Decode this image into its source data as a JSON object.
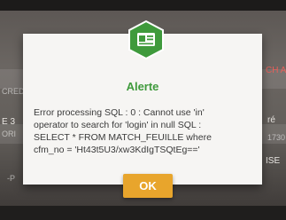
{
  "background": {
    "left_partial_1": "CRED",
    "left_partial_2": "E 3",
    "left_partial_3": "ORI",
    "left_partial_4": "-P",
    "right_partial_1": "CH A",
    "right_partial_2": "ré",
    "right_partial_3": "1730",
    "right_partial_4": "ISE"
  },
  "dialog": {
    "title": "Alerte",
    "message_lines": [
      "Error processing SQL : 0 : Cannot use 'in'",
      "operator to search for 'login' in null SQL :",
      "SELECT * FROM MATCH_FEUILLE where",
      "cfm_no = 'Ht43t5U3/xw3KdIgTSQtEg=='"
    ],
    "ok_label": "OK",
    "icon": "id-card-icon"
  },
  "colors": {
    "accent_green": "#3f9a3c",
    "ok_orange": "#e8a52c",
    "background_red": "#e8605a"
  }
}
